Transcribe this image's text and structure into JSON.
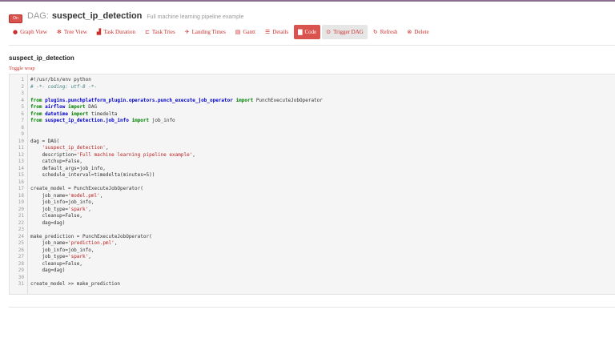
{
  "header": {
    "toggle_label": "On",
    "prefix": "DAG:",
    "dag_id": "suspect_ip_detection",
    "description": "Full machine learning pipeline example"
  },
  "nav": [
    {
      "label": "Graph View",
      "icon": "circle-icon",
      "glyph": "●"
    },
    {
      "label": "Tree View",
      "icon": "tree-icon",
      "glyph": "✻"
    },
    {
      "label": "Task Duration",
      "icon": "bar-chart-icon",
      "glyph": "▟"
    },
    {
      "label": "Task Tries",
      "icon": "tries-icon",
      "glyph": "⊏"
    },
    {
      "label": "Landing Times",
      "icon": "plane-icon",
      "glyph": "✈"
    },
    {
      "label": "Gantt",
      "icon": "gantt-icon",
      "glyph": "▤"
    },
    {
      "label": "Details",
      "icon": "list-icon",
      "glyph": "☰"
    },
    {
      "label": "Code",
      "icon": "file-icon",
      "glyph": "▇",
      "active": true
    },
    {
      "label": "Trigger DAG",
      "icon": "play-circle-icon",
      "glyph": "⊙"
    },
    {
      "label": "Refresh",
      "icon": "refresh-icon",
      "glyph": "↻"
    },
    {
      "label": "Delete",
      "icon": "remove-icon",
      "glyph": "⊗"
    }
  ],
  "page_title": "suspect_ip_detection",
  "toggle_wrap": "Toggle wrap",
  "code_lines": [
    [
      [
        "#!/usr/bin/env python",
        ""
      ]
    ],
    [
      [
        "# -*- coding: utf-8 -*-",
        "cm"
      ]
    ],
    [
      [
        "",
        ""
      ]
    ],
    [
      [
        "from",
        "kw"
      ],
      [
        " ",
        ""
      ],
      [
        "plugins.punchplatform_plugin.operators.punch_execute_job_operator",
        "mod"
      ],
      [
        " ",
        ""
      ],
      [
        "import",
        "kw"
      ],
      [
        " PunchExecuteJobOperator",
        ""
      ]
    ],
    [
      [
        "from",
        "kw"
      ],
      [
        " ",
        ""
      ],
      [
        "airflow",
        "mod"
      ],
      [
        " ",
        ""
      ],
      [
        "import",
        "kw"
      ],
      [
        " DAG",
        ""
      ]
    ],
    [
      [
        "from",
        "kw"
      ],
      [
        " ",
        ""
      ],
      [
        "datetime",
        "mod"
      ],
      [
        " ",
        ""
      ],
      [
        "import",
        "kw"
      ],
      [
        " timedelta",
        ""
      ]
    ],
    [
      [
        "from",
        "kw"
      ],
      [
        " ",
        ""
      ],
      [
        "suspect_ip_detection.job_info",
        "mod"
      ],
      [
        " ",
        ""
      ],
      [
        "import",
        "kw"
      ],
      [
        " job_info",
        ""
      ]
    ],
    [
      [
        "",
        ""
      ]
    ],
    [
      [
        "",
        ""
      ]
    ],
    [
      [
        "dag = DAG(",
        ""
      ]
    ],
    [
      [
        "    ",
        ""
      ],
      [
        "'suspect_ip_detection'",
        "str"
      ],
      [
        ",",
        ""
      ]
    ],
    [
      [
        "    description=",
        ""
      ],
      [
        "'Full machine learning pipeline example'",
        "str"
      ],
      [
        ",",
        ""
      ]
    ],
    [
      [
        "    catchup=False,",
        ""
      ]
    ],
    [
      [
        "    default_args=job_info,",
        ""
      ]
    ],
    [
      [
        "    schedule_interval=timedelta(minutes=5))",
        ""
      ]
    ],
    [
      [
        "",
        ""
      ]
    ],
    [
      [
        "create_model = PunchExecuteJobOperator(",
        ""
      ]
    ],
    [
      [
        "    job_name=",
        ""
      ],
      [
        "'model.pml'",
        "str"
      ],
      [
        ",",
        ""
      ]
    ],
    [
      [
        "    job_info=job_info,",
        ""
      ]
    ],
    [
      [
        "    job_type=",
        ""
      ],
      [
        "'spark'",
        "str"
      ],
      [
        ",",
        ""
      ]
    ],
    [
      [
        "    cleanup=False,",
        ""
      ]
    ],
    [
      [
        "    dag=dag)",
        ""
      ]
    ],
    [
      [
        "",
        ""
      ]
    ],
    [
      [
        "make_prediction = PunchExecuteJobOperator(",
        ""
      ]
    ],
    [
      [
        "    job_name=",
        ""
      ],
      [
        "'prediction.pml'",
        "str"
      ],
      [
        ",",
        ""
      ]
    ],
    [
      [
        "    job_info=job_info,",
        ""
      ]
    ],
    [
      [
        "    job_type=",
        ""
      ],
      [
        "'spark'",
        "str"
      ],
      [
        ",",
        ""
      ]
    ],
    [
      [
        "    cleanup=False,",
        ""
      ]
    ],
    [
      [
        "    dag=dag)",
        ""
      ]
    ],
    [
      [
        "",
        ""
      ]
    ],
    [
      [
        "create_model >> make_prediction",
        ""
      ]
    ]
  ]
}
